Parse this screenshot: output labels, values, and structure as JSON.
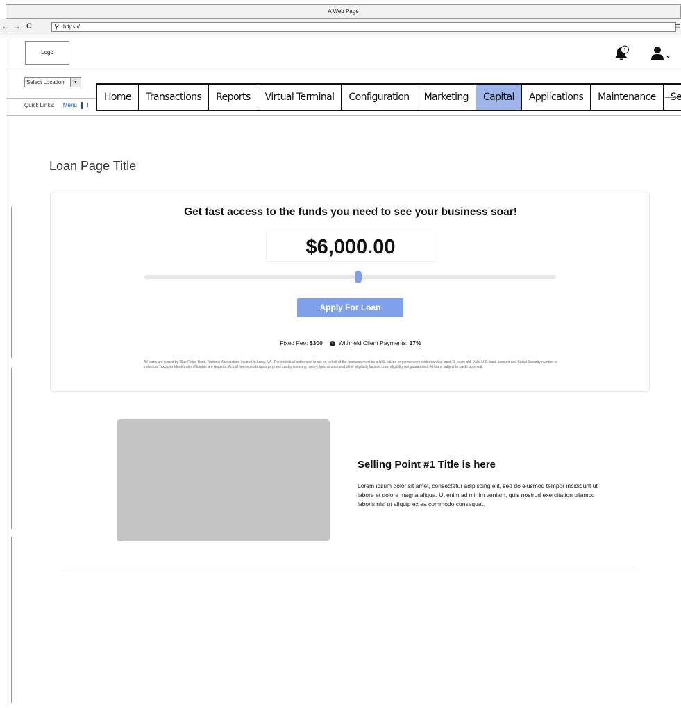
{
  "browser": {
    "title": "A Web Page",
    "url": "https://",
    "back_glyph": "←",
    "forward_glyph": "→",
    "reload_glyph": "C",
    "search_glyph": "⚲",
    "menu_glyph": "≡"
  },
  "header": {
    "logo_text": "Logo",
    "notification_count": "1",
    "icons": [
      "bell-icon",
      "user-icon",
      "chevron-down-icon"
    ]
  },
  "location": {
    "selected": "Select Location",
    "arrow": "▼"
  },
  "quick_links": {
    "label": "Quick Links:",
    "items": [
      "Menu"
    ],
    "overflow": "I"
  },
  "nav": {
    "items": [
      "Home",
      "Transactions",
      "Reports",
      "Virtual Terminal",
      "Configuration",
      "Marketing",
      "Capital",
      "Applications",
      "Maintenance",
      "Settings"
    ],
    "active": "Capital"
  },
  "page": {
    "title": "Loan Page Title"
  },
  "loan_card": {
    "headline": "Get fast access to the funds you need to see your business soar!",
    "amount": "$6,000.00",
    "slider_position": 0.52,
    "apply_label": "Apply For Loan",
    "fixed_fee_label": "Fixed Fee:",
    "fixed_fee_value": "$300",
    "info_glyph": "i",
    "withheld_label": "Withheld Client Payments:",
    "withheld_value": "17%",
    "disclaimer": "All loans are issued by Blue Ridge Bank, National Association, located in Luray, VA. The individual authorized to act on behalf of the business must be a U.S. citizen or permanent resident and at least 18 years old. Valid U.S. bank account and Social Security number or individual Taxpayer Identification Number are required. Actual fee depends upon payment card processing history, loan amount and other eligibility factors. Loan eligibility not guaranteed. All loans subject to credit approval."
  },
  "selling_point": {
    "title": "Selling Point #1 Title is here",
    "body": "Lorem ipsum dolor sit amet, consectetur adipiscing elit, sed do eiusmod tempor incididunt ut labore et dolore magna aliqua. Ut enim ad minim veniam, quis nostrud exercitation ullamco laboris nisi ut aliquip ex ea commodo consequat."
  },
  "colors": {
    "accent": "#7ea1ea",
    "nav_active": "#9fb4e8",
    "placeholder": "#c3c3c3"
  }
}
